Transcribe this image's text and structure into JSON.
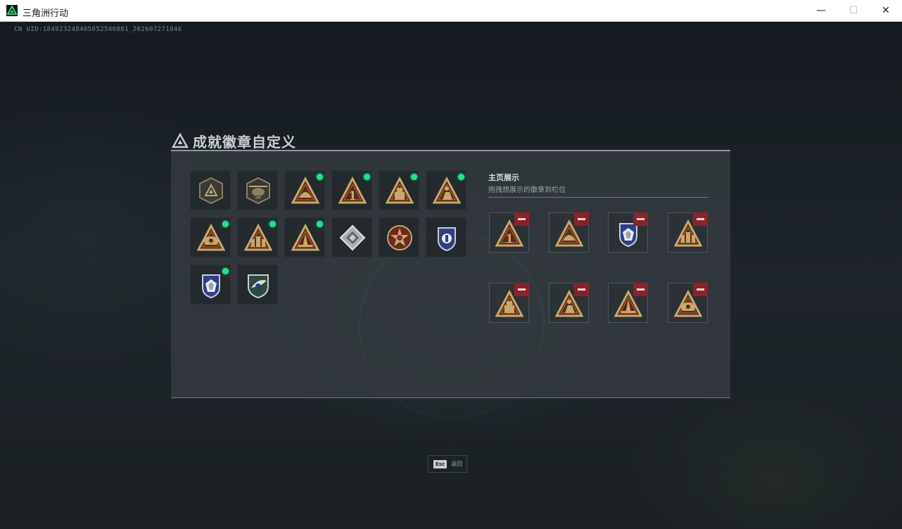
{
  "window": {
    "title": "三角洲行动",
    "minimize_glyph": "—",
    "maximize_glyph": "☐",
    "close_glyph": "✕"
  },
  "uid": "CN UID:184923248405052500881_202607271846",
  "panel": {
    "title": "成就徽章自定义",
    "title_icon": "delta-triangle-icon"
  },
  "inventory": [
    {
      "icon": "delta-shield-badge",
      "new": false
    },
    {
      "icon": "helicopter-badge",
      "new": false
    },
    {
      "icon": "triangle-dome-badge",
      "new": true
    },
    {
      "icon": "triangle-number-one-badge",
      "new": true
    },
    {
      "icon": "triangle-crate-badge",
      "new": true
    },
    {
      "icon": "triangle-runner-badge",
      "new": true
    },
    {
      "icon": "triangle-wings-badge",
      "new": true
    },
    {
      "icon": "triangle-squad-badge",
      "new": true
    },
    {
      "icon": "triangle-tower-badge",
      "new": true
    },
    {
      "icon": "diamond-crystal-badge",
      "new": false
    },
    {
      "icon": "star-medal-badge",
      "new": false
    },
    {
      "icon": "police-shield-badge",
      "new": false
    },
    {
      "icon": "police-crest-badge",
      "new": true
    },
    {
      "icon": "green-wing-shield-badge",
      "new": false
    }
  ],
  "showcase": {
    "title": "主页展示",
    "subtitle": "拖拽想展示的徽章到栏位",
    "slots": [
      {
        "icon": "triangle-number-one-badge"
      },
      {
        "icon": "triangle-dome-badge"
      },
      {
        "icon": "police-crest-badge"
      },
      {
        "icon": "triangle-squad-badge"
      },
      {
        "icon": "triangle-crate-badge"
      },
      {
        "icon": "triangle-runner-badge"
      },
      {
        "icon": "triangle-tower-badge"
      },
      {
        "icon": "triangle-wings-badge"
      }
    ]
  },
  "footer": {
    "esc_key": "Esc",
    "esc_label": "返回"
  },
  "colors": {
    "gold": "#c9a66b",
    "gold_dark": "#5a2a18",
    "new_dot": "#1fe58a",
    "remove": "#8c2229",
    "police_blue": "#2f3f86"
  }
}
